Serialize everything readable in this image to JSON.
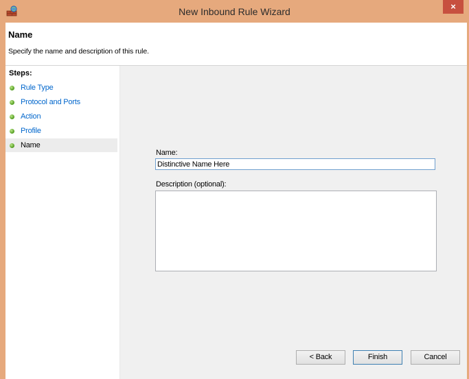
{
  "window": {
    "title": "New Inbound Rule Wizard",
    "close_label": "×"
  },
  "header": {
    "title": "Name",
    "subtitle": "Specify the name and description of this rule."
  },
  "steps": {
    "title": "Steps:",
    "items": [
      {
        "label": "Rule Type",
        "current": false
      },
      {
        "label": "Protocol and Ports",
        "current": false
      },
      {
        "label": "Action",
        "current": false
      },
      {
        "label": "Profile",
        "current": false
      },
      {
        "label": "Name",
        "current": true
      }
    ]
  },
  "form": {
    "name_label": "Name:",
    "name_value": "Distinctive Name Here",
    "description_label": "Description (optional):",
    "description_value": ""
  },
  "buttons": {
    "back": "< Back",
    "finish": "Finish",
    "cancel": "Cancel"
  },
  "colors": {
    "title_bar": "#e6a97d",
    "link": "#0066cc",
    "close_button": "#c7503f"
  }
}
